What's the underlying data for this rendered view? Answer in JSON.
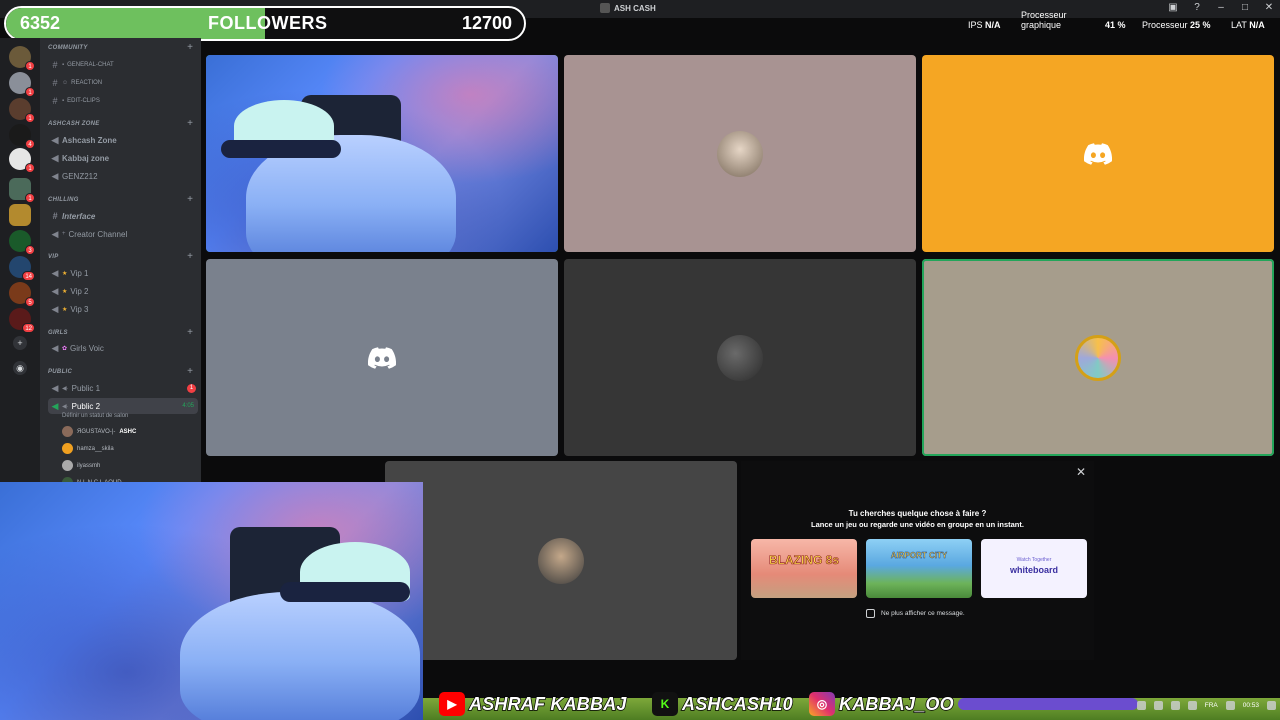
{
  "window": {
    "title": "ASH CASH"
  },
  "followers": {
    "current": "6352",
    "label": "FOLLOWERS",
    "goal": "12700",
    "progress_fraction": 0.5
  },
  "stats": {
    "ips_label": "IPS",
    "ips_value": "N/A",
    "gpu_label_1": "Processeur",
    "gpu_label_2": "graphique",
    "gpu_value": "41 %",
    "cpu_label": "Processeur",
    "cpu_value": "25 %",
    "lat_label": "LAT",
    "lat_value": "N/A"
  },
  "rail": {
    "badges": [
      "1",
      "1",
      "1",
      "4",
      "1",
      "1",
      "3",
      "14",
      "5",
      "12"
    ]
  },
  "sidebar": {
    "categories": {
      "community": "COMMUNITY",
      "ashcash_zone": "ASHCASH ZONE",
      "chilling": "CHILLING",
      "vip": "VIP",
      "girls": "GIRLS",
      "public": "PUBLIC"
    },
    "channels": {
      "general_chat": "GENERAL-CHAT",
      "reaction": "REACTION",
      "edit_clips": "EDIT-CLIPS",
      "ashcash_zone": "Ashcash Zone",
      "kabbaj_zone": "Kabbaj zone",
      "genz212": "GENZ212",
      "interface": "Interface",
      "creator_channel": "Creator Channel",
      "vip1": "Vip 1",
      "vip2": "Vip 2",
      "vip3": "Vip 3",
      "girls_voic": "Girls Voic",
      "public1": "Public 1",
      "public1_badge": "1",
      "public2": "Public 2",
      "public2_timer": "4:05",
      "status_hint": "Définir un statut de salon"
    },
    "members": {
      "m1": "ЯGUSTAVO-|-",
      "m1_tag": "ASHC",
      "m2": "hamza__skila",
      "m3": "ilyassmh",
      "m4": "N L N C L AOUD"
    }
  },
  "activity": {
    "question": "Tu cherches quelque chose à faire ?",
    "description": "Lance un jeu ou regarde une vidéo en groupe en un instant.",
    "cards": [
      "BLAZING 8s",
      "AIRPORT CITY",
      "whiteboard"
    ],
    "card_tag": "Watch Together",
    "dont_show": "Ne plus afficher ce message."
  },
  "socials": {
    "youtube": "ASHRAF KABBAJ",
    "kick": "ASHCASH10",
    "instagram": "KABBAJ_OO",
    "kick_logo": "K"
  },
  "taskbar": {
    "lang": "FRA",
    "time": "00:53"
  },
  "colors": {
    "accent_green": "#6ec05e",
    "discord_orange": "#f5a623",
    "tile_rose": "#a89392",
    "tile_slate": "#7a818d",
    "tile_dark": "#363636",
    "tile_khaki": "#a69d8c",
    "youtube_red": "#ff0000",
    "kick_green": "#53fc18",
    "instagram_pink": "#e1306c"
  },
  "icons": [
    "hash-icon",
    "speaker-icon",
    "star-icon",
    "plus-icon",
    "close-icon",
    "discord-logo-icon",
    "explore-icon",
    "add-server-icon"
  ]
}
